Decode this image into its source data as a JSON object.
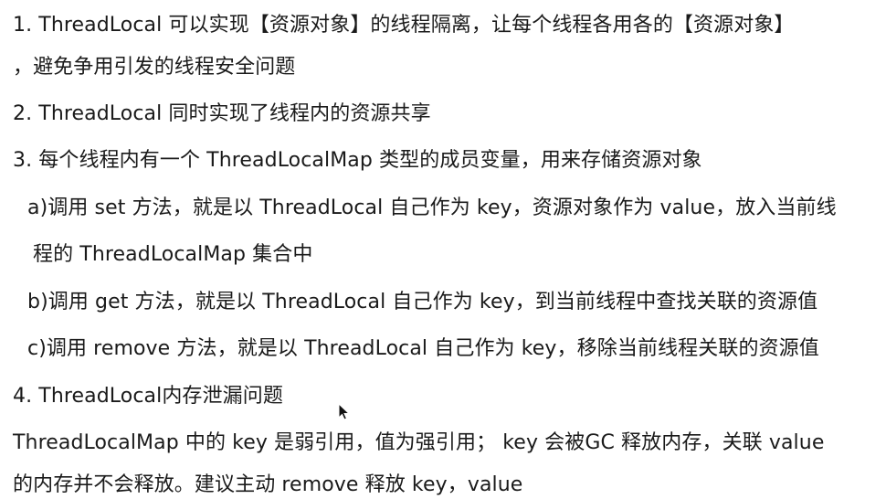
{
  "lines": [
    "1. ThreadLocal 可以实现【资源对象】的线程隔离，让每个线程各用各的【资源对象】",
    "，避免争用引发的线程安全问题",
    "2. ThreadLocal 同时实现了线程内的资源共享",
    "3. 每个线程内有一个 ThreadLocalMap 类型的成员变量，用来存储资源对象",
    "a)调用 set 方法，就是以 ThreadLocal 自己作为 key，资源对象作为 value，放入当前线",
    "程的 ThreadLocalMap 集合中",
    "b)调用 get 方法，就是以 ThreadLocal 自己作为 key，到当前线程中查找关联的资源值",
    "c)调用 remove 方法，就是以 ThreadLocal 自己作为 key，移除当前线程关联的资源值",
    "4. ThreadLocal内存泄漏问题",
    "ThreadLocalMap 中的 key 是弱引用，值为强引用； key 会被GC 释放内存，关联 value",
    "的内存并不会释放。建议主动 remove 释放 key，value"
  ],
  "cursor_icon": "mouse-pointer-icon"
}
